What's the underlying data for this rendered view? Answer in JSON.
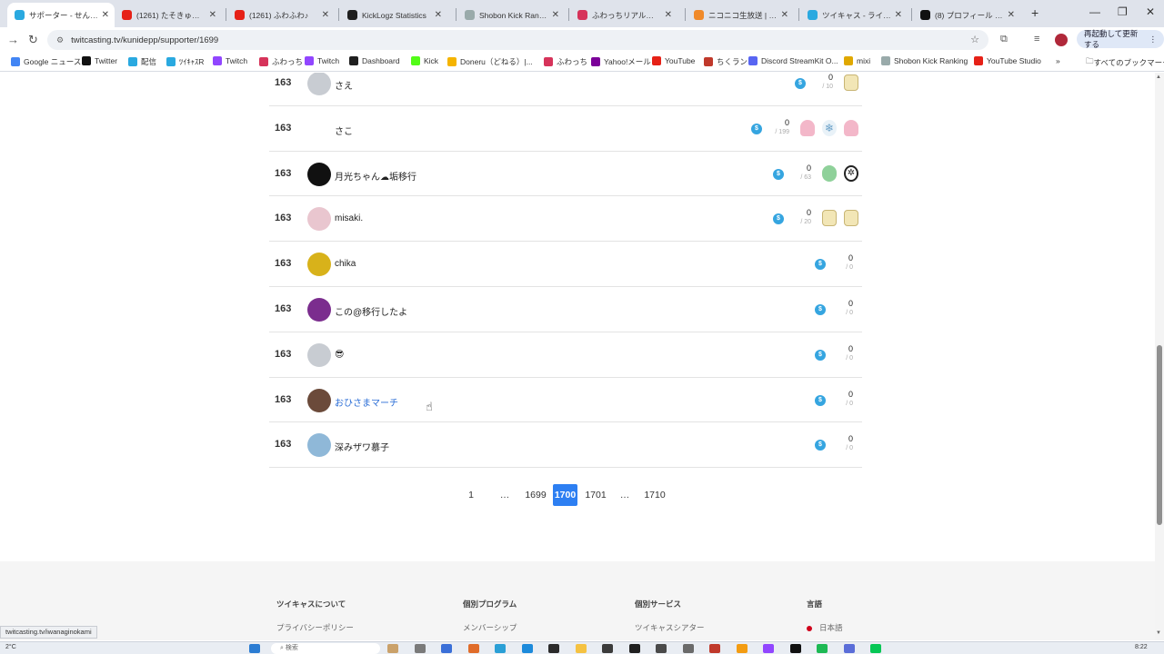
{
  "browser": {
    "tabs": [
      {
        "title": "サポーター - せんちょさん",
        "active": true,
        "color": "#2aa9e0"
      },
      {
        "title": "(1261) たそきゅんアカウ",
        "color": "#e62117"
      },
      {
        "title": "(1261) ふわふわ♪",
        "color": "#e62117"
      },
      {
        "title": "KickLogz Statistics",
        "color": "#1f1f1f"
      },
      {
        "title": "Shobon Kick Ranking",
        "color": "#9aa"
      },
      {
        "title": "ふわっちリアルタイムラン",
        "color": "#d6335a"
      },
      {
        "title": "ニコニコ生放送 | リアル",
        "color": "#f08a2a"
      },
      {
        "title": "ツイキャス - ライブでつな",
        "color": "#2aa9e0"
      },
      {
        "title": "(8) プロフィール / X",
        "color": "#111"
      }
    ],
    "close_glyph": "✕",
    "new_tab_glyph": "+",
    "window_controls": [
      "—",
      "❐",
      "✕"
    ],
    "url": "twitcasting.tv/kunidepp/supporter/1699",
    "relaunch_label": "再起動して更新する",
    "bookmarks": [
      {
        "label": "Google ニュース",
        "color": "#4285f4"
      },
      {
        "label": "Twitter",
        "color": "#111"
      },
      {
        "label": "配信",
        "color": "#2aa9e0"
      },
      {
        "label": "ﾂｲｷｬｽR",
        "color": "#2aa9e0"
      },
      {
        "label": "Twitch",
        "color": "#9146ff"
      },
      {
        "label": "ふわっち",
        "color": "#d6335a"
      },
      {
        "label": "Twitch",
        "color": "#9146ff"
      },
      {
        "label": "Dashboard",
        "color": "#1f1f1f"
      },
      {
        "label": "Kick",
        "color": "#53fc18"
      },
      {
        "label": "Doneru（どねる）|...",
        "color": "#f5b400"
      },
      {
        "label": "ふわっち",
        "color": "#d6335a"
      },
      {
        "label": "Yahoo!メール",
        "color": "#7b0099"
      },
      {
        "label": "YouTube",
        "color": "#e62117"
      },
      {
        "label": "ちくラン",
        "color": "#c0392b"
      },
      {
        "label": "Discord StreamKit O...",
        "color": "#5865f2"
      },
      {
        "label": "mixi",
        "color": "#e0a800"
      },
      {
        "label": "Shobon Kick Ranking",
        "color": "#9aa"
      },
      {
        "label": "YouTube Studio",
        "color": "#e62117"
      }
    ],
    "more_glyph": "»",
    "all_bookmarks_label": "すべてのブックマーク",
    "status_url": "twitcasting.tv/iwanaginokami"
  },
  "supporters": [
    {
      "rank": "163",
      "name": "さえ",
      "avatar": "#c8ccd2",
      "points": "0",
      "of": "/ 10",
      "items": [
        "gold"
      ]
    },
    {
      "rank": "163",
      "name": "さこ",
      "avatar": "#ffffff",
      "points": "0",
      "of": "/ 199",
      "items": [
        "pink",
        "snow",
        "pink"
      ]
    },
    {
      "rank": "163",
      "name": "月光ちゃん☁垢移行",
      "avatar": "#111111",
      "points": "0",
      "of": "/ 63",
      "items": [
        "green",
        "dark"
      ]
    },
    {
      "rank": "163",
      "name": "misaki.",
      "avatar": "#e9c6cf",
      "points": "0",
      "of": "/ 20",
      "items": [
        "gold",
        "gold"
      ]
    },
    {
      "rank": "163",
      "name": "chika",
      "avatar": "#d8b21a",
      "points": "0",
      "of": "/ 0",
      "items": []
    },
    {
      "rank": "163",
      "name": "この@移行したよ",
      "avatar": "#7b2d8e",
      "points": "0",
      "of": "/ 0",
      "items": []
    },
    {
      "rank": "163",
      "name": "😎",
      "avatar": "#c8ccd2",
      "points": "0",
      "of": "/ 0",
      "items": []
    },
    {
      "rank": "163",
      "name": "おひさまマーチ",
      "avatar": "#6b4a3a",
      "points": "0",
      "of": "/ 0",
      "items": [],
      "link": true
    },
    {
      "rank": "163",
      "name": "深みザワ慕子",
      "avatar": "#8fb8d8",
      "points": "0",
      "of": "/ 0",
      "items": []
    }
  ],
  "coin_glyph": "$",
  "pagination": {
    "items": [
      "1",
      "…",
      "1699",
      "1700",
      "1701",
      "…",
      "1710"
    ],
    "current": "1700"
  },
  "footer": {
    "columns": [
      {
        "heading": "ツイキャスについて",
        "item": "プライバシーポリシー"
      },
      {
        "heading": "個別プログラム",
        "item": "メンバーシップ"
      },
      {
        "heading": "個別サービス",
        "item": "ツイキャスシアター"
      },
      {
        "heading": "言語",
        "item": "日本語"
      }
    ]
  },
  "taskbar": {
    "temperature": "2°C",
    "search_placeholder": "検索",
    "time": "8:22"
  }
}
